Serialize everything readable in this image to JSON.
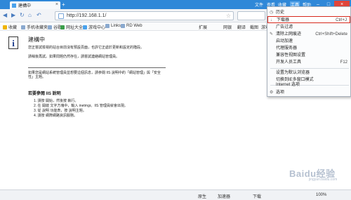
{
  "titlebar": {
    "tab_label": "建構中",
    "text_items": [
      "文件",
      "查看",
      "收藏",
      "工具",
      "帮助"
    ]
  },
  "address": {
    "url": "http://192.168.1.1/"
  },
  "favbar": {
    "items": [
      "收藏",
      "手机收藏夹",
      "谷歌",
      "网址大全",
      "游戏中心",
      "Links",
      "RD Web"
    ],
    "right": [
      "扩展",
      "网银",
      "翻译",
      "截图",
      "游戏"
    ]
  },
  "page": {
    "title": "建構中",
    "p1": "您正嘗試檢視的站台目前沒有預設頁面，也許它正處於更新和設定的階段。",
    "p2": "請稍後再試。如果問題仍然存在，請嘗試連絡網站管理員。",
    "p3": "如果您是網站系統管理員並想要這個訊息，請參閱 IIS 說明中的「網站管理」與「安全性」主題。",
    "h3": "若要參閱 IIS 說明",
    "steps": [
      "1. 請按 開始，然後按 執行。",
      "2. 在 開啟 文字方塊中，輸入 inetmgr。IIS 管理員就會出現。",
      "3. 從 說明 功能表，按 說明主題。",
      "4. 請按 網際網路資訊服務。"
    ]
  },
  "menu": {
    "items": [
      {
        "label": "历史",
        "shortcut": ""
      },
      {
        "label": "下载器",
        "shortcut": "Ctrl+J"
      },
      {
        "label": "广告过滤",
        "shortcut": ""
      },
      {
        "label": "清除上网痕迹",
        "shortcut": "Ctrl+Shift+Delete"
      },
      {
        "label": "启动加速",
        "shortcut": ""
      },
      {
        "label": "代理服务器",
        "shortcut": ""
      },
      {
        "label": "兼容性视图设置",
        "shortcut": ""
      },
      {
        "label": "开发人员工具",
        "shortcut": "F12"
      },
      {
        "label": "设置为默认浏览器",
        "shortcut": ""
      },
      {
        "label": "切换到IE多窗口模式",
        "shortcut": ""
      },
      {
        "label": "Internet 选项",
        "shortcut": ""
      },
      {
        "label": "选项",
        "shortcut": ""
      }
    ]
  },
  "status": {
    "left": "",
    "items": [
      "原生",
      "加速器",
      "下载",
      "100%"
    ]
  },
  "watermark": {
    "main": "Baidu经验",
    "sub": "jingyan.baidu.com"
  }
}
